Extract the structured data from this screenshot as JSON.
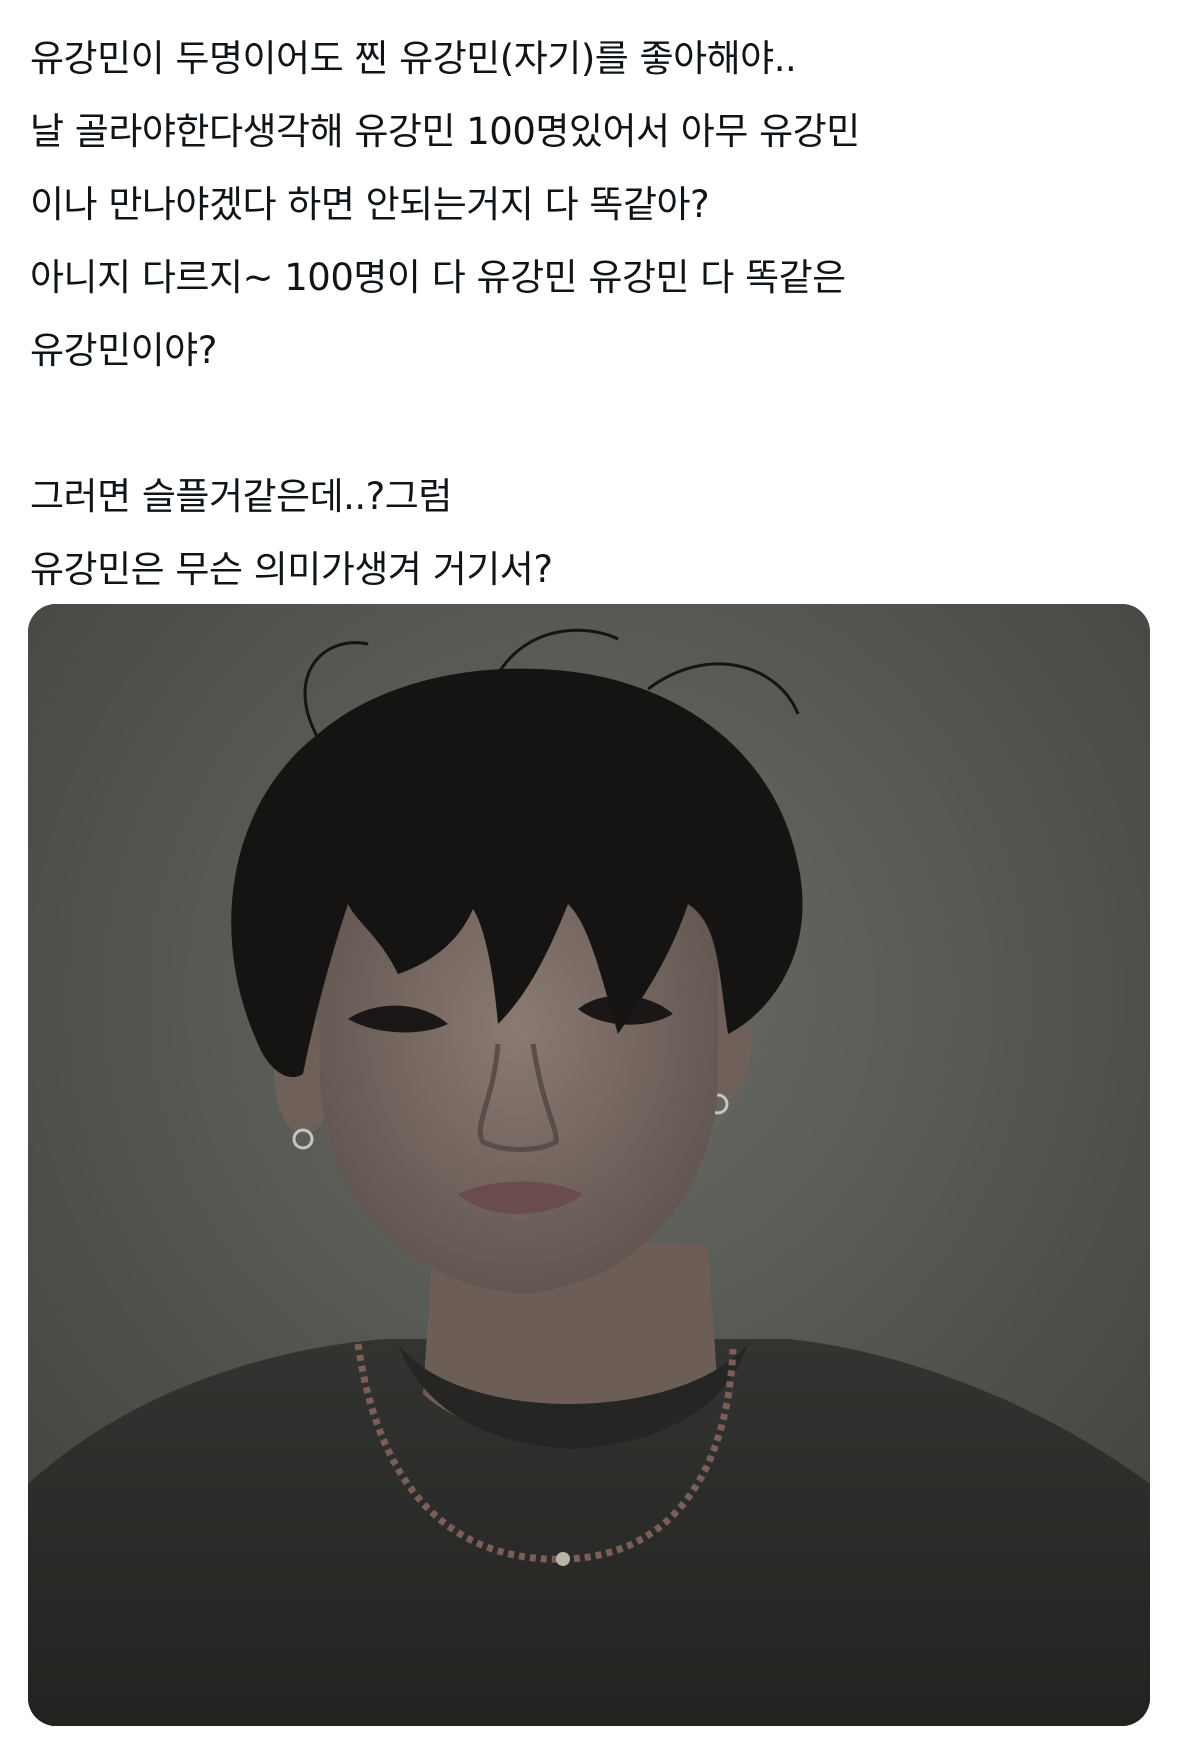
{
  "post": {
    "lines": [
      "유강민이 두명이어도 찐 유강민(자기)를 좋아해야..",
      "날 골라야한다생각해 유강민 100명있어서 아무 유강민",
      "이나 만나야겠다 하면 안되는거지 다 똑같아?",
      "아니지 다르지~ 100명이 다 유강민 유강민 다 똑같은",
      "유강민이야?",
      "그러면 슬플거같은데..?그럼",
      "유강민은 무슨 의미가생겨 거기서?"
    ]
  },
  "media": {
    "kind": "photo",
    "subject": "portrait-photo",
    "colors": {
      "wall": "#5a5c56",
      "hair": "#151412",
      "skin": "#7d6d66",
      "shirt": "#2b2c2a"
    }
  }
}
